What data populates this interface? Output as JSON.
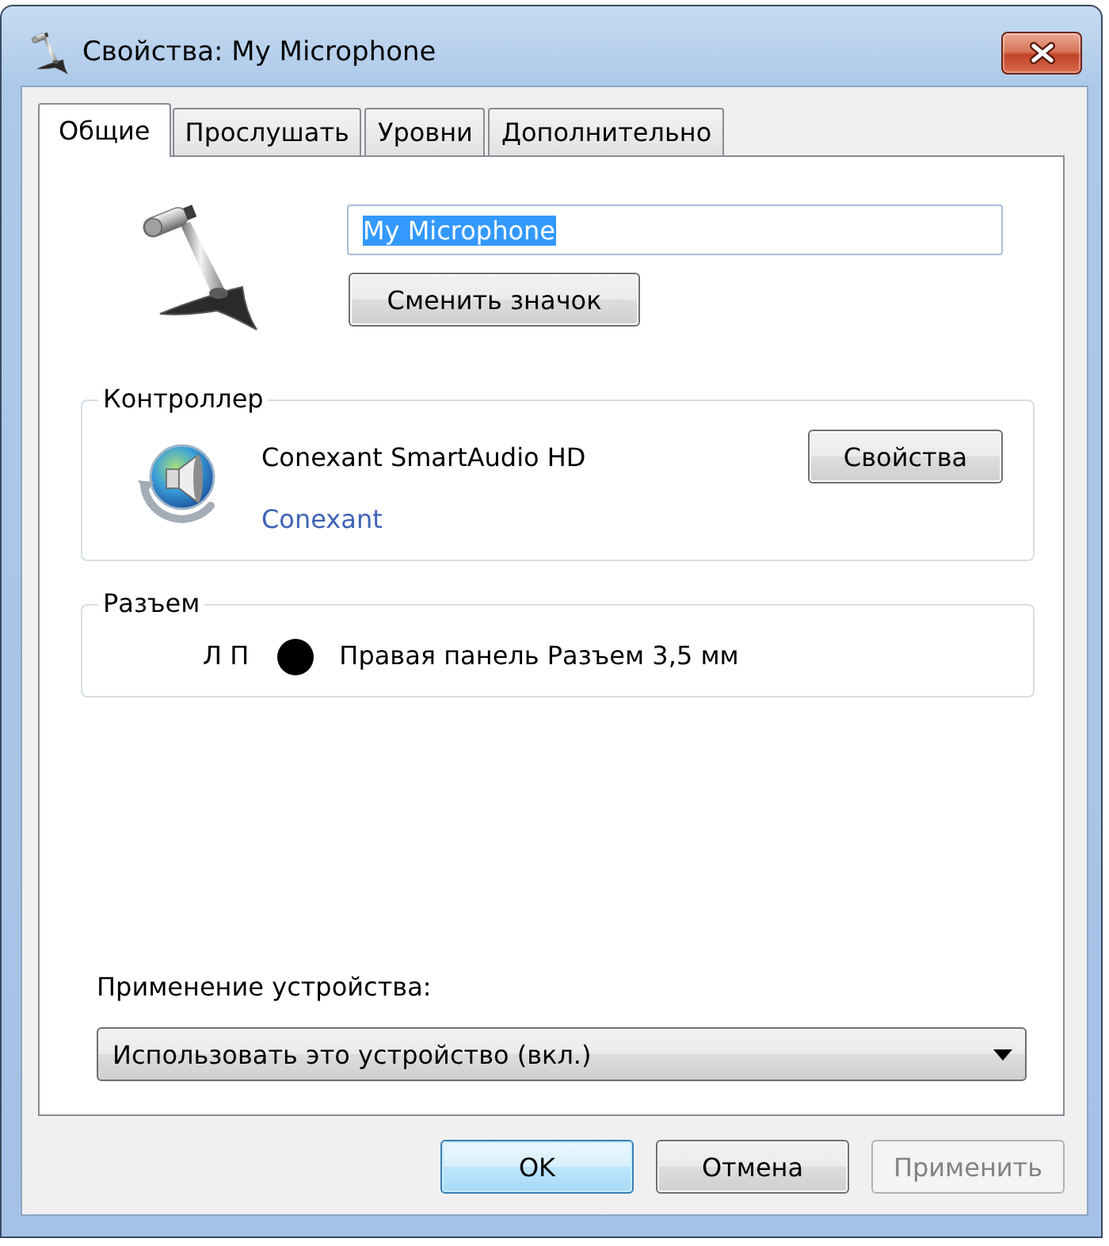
{
  "window": {
    "title": "Свойства: My Microphone"
  },
  "tabs": [
    {
      "label": "Общие",
      "selected": true
    },
    {
      "label": "Прослушать",
      "selected": false
    },
    {
      "label": "Уровни",
      "selected": false
    },
    {
      "label": "Дополнительно",
      "selected": false
    }
  ],
  "device": {
    "name_field": {
      "value": "My Microphone",
      "text_selected": true
    },
    "change_icon_button": "Сменить значок"
  },
  "controller": {
    "title": "Контроллер",
    "name": "Conexant SmartAudio HD",
    "vendor_link": "Conexant",
    "properties_button": "Свойства"
  },
  "jack": {
    "title": "Разъем",
    "channels": "Л П",
    "color": "#000000",
    "description": "Правая панель Разъем 3,5 мм"
  },
  "device_usage": {
    "label": "Применение устройства:",
    "value": "Использовать это устройство (вкл.)"
  },
  "buttons": [
    {
      "label": "OK",
      "default": true,
      "disabled": false
    },
    {
      "label": "Отмена",
      "default": false,
      "disabled": false
    },
    {
      "label": "Применить",
      "default": false,
      "disabled": true
    }
  ]
}
